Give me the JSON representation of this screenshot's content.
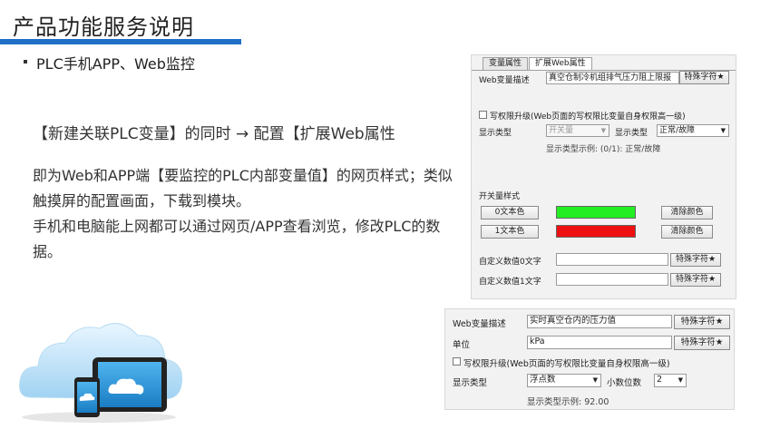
{
  "slide": {
    "title": "产品功能服务说明",
    "bullet": "PLC手机APP、Web监控",
    "headline": "【新建关联PLC变量】的同时 → 配置【扩展Web属性",
    "para1": "即为Web和APP端【要监控的PLC内部变量值】的网页样式；类似触摸屏的配置画面，下载到模块。",
    "para2": "手机和电脑能上网都可以通过网页/APP查看浏览，修改PLC的数据。"
  },
  "colors": {
    "accent": "#1f6fc4",
    "on_color": "#22ee22",
    "off_color": "#ee1111"
  },
  "panel_a": {
    "tabs": [
      {
        "label": "变量属性"
      },
      {
        "label": "扩展Web属性"
      }
    ],
    "active_tab": 1,
    "web_desc_label": "Web变量描述",
    "web_desc_value": "真空仓制冷机组排气压力阻上限报",
    "special_char_label": "特殊字符★",
    "write_upgrade_label": "写权限升级(Web页面的写权限比变量自身权限高一级)",
    "display_type_label": "显示类型",
    "display_type_value": "开关量",
    "display_type2_label": "显示类型",
    "display_type2_value": "正常/故障",
    "example_text": "显示类型示例: (0/1): 正常/故障",
    "switch_style_label": "开关量样式",
    "text0_color_label": "0文本色",
    "text1_color_label": "1文本色",
    "clear_color_label": "清除颜色",
    "custom0_label": "自定义数值0文字",
    "custom1_label": "自定义数值1文字",
    "custom0_value": "",
    "custom1_value": ""
  },
  "panel_b": {
    "web_desc_label": "Web变量描述",
    "web_desc_value": "实时真空仓内的压力值",
    "special_char_label": "特殊字符★",
    "unit_label": "单位",
    "unit_value": "kPa",
    "write_upgrade_label": "写权限升级(Web页面的写权限比变量自身权限高一级)",
    "display_type_label": "显示类型",
    "display_type_value": "浮点数",
    "decimals_label": "小数位数",
    "decimals_value": "2",
    "example_text": "显示类型示例: 92.00"
  }
}
